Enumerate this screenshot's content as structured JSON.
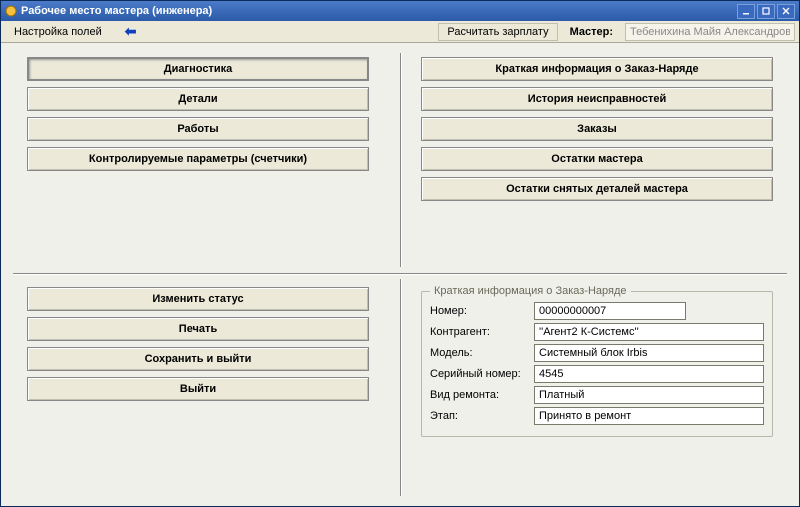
{
  "window": {
    "title": "Рабочее место мастера (инженера)"
  },
  "toolbar": {
    "settings_label": "Настройка полей",
    "calc_salary_label": "Расчитать зарплату",
    "master_caption": "Мастер:",
    "master_value": "Тебенихина Майя Александровна"
  },
  "left_buttons": {
    "diagnostics": "Диагностика",
    "parts": "Детали",
    "works": "Работы",
    "controlled_params": "Контролируемые параметры (счетчики)"
  },
  "right_buttons": {
    "order_info": "Краткая информация о Заказ-Наряде",
    "fault_history": "История неисправностей",
    "orders": "Заказы",
    "master_remains": "Остатки мастера",
    "removed_parts_remains": "Остатки снятых деталей мастера"
  },
  "action_buttons": {
    "change_status": "Изменить статус",
    "print": "Печать",
    "save_exit": "Сохранить и выйти",
    "exit": "Выйти"
  },
  "info_panel": {
    "legend": "Краткая информация о Заказ-Наряде",
    "labels": {
      "number": "Номер:",
      "contractor": "Контрагент:",
      "model": "Модель:",
      "serial": "Серийный номер:",
      "repair_type": "Вид ремонта:",
      "stage": "Этап:"
    },
    "values": {
      "number": "00000000007",
      "contractor": "''Агент2 К-Системс''",
      "model": "Системный блок Irbis",
      "serial": "4545",
      "repair_type": "Платный",
      "stage": "Принято в ремонт"
    }
  }
}
